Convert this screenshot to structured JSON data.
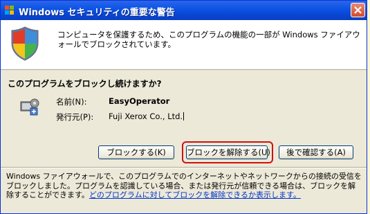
{
  "window": {
    "title": "Windows セキュリティの重要な警告"
  },
  "banner": {
    "message": "コンピュータを保護するため、このプログラムの機能の一部が Windows ファイアウォールでブロックされています。"
  },
  "question": "このプログラムをブロックし続けますか?",
  "program": {
    "name_label": "名前(N):",
    "name_value": "EasyOperator",
    "publisher_label": "発行元(P):",
    "publisher_value": "Fuji Xerox Co., Ltd."
  },
  "buttons": {
    "keep_blocking": "ブロックする(K)",
    "unblock": "ブロックを解除する(U)",
    "ask_later": "後で確認する(A)"
  },
  "footer": {
    "text": "Windows ファイアウォールで、このプログラムでのインターネットやネットワークからの接続の受信をブロックしました。プログラムを認識している場合、または発行元が信頼できる場合は、ブロックを解除することができます。",
    "link": "どのプログラムに対してブロックを解除できるか表示します。"
  },
  "colors": {
    "titlebar": "#0a47d4",
    "highlight": "#d01010",
    "link": "#0033cc"
  },
  "icons": [
    "app-icon",
    "close-icon",
    "shield-icon",
    "program-icon"
  ]
}
